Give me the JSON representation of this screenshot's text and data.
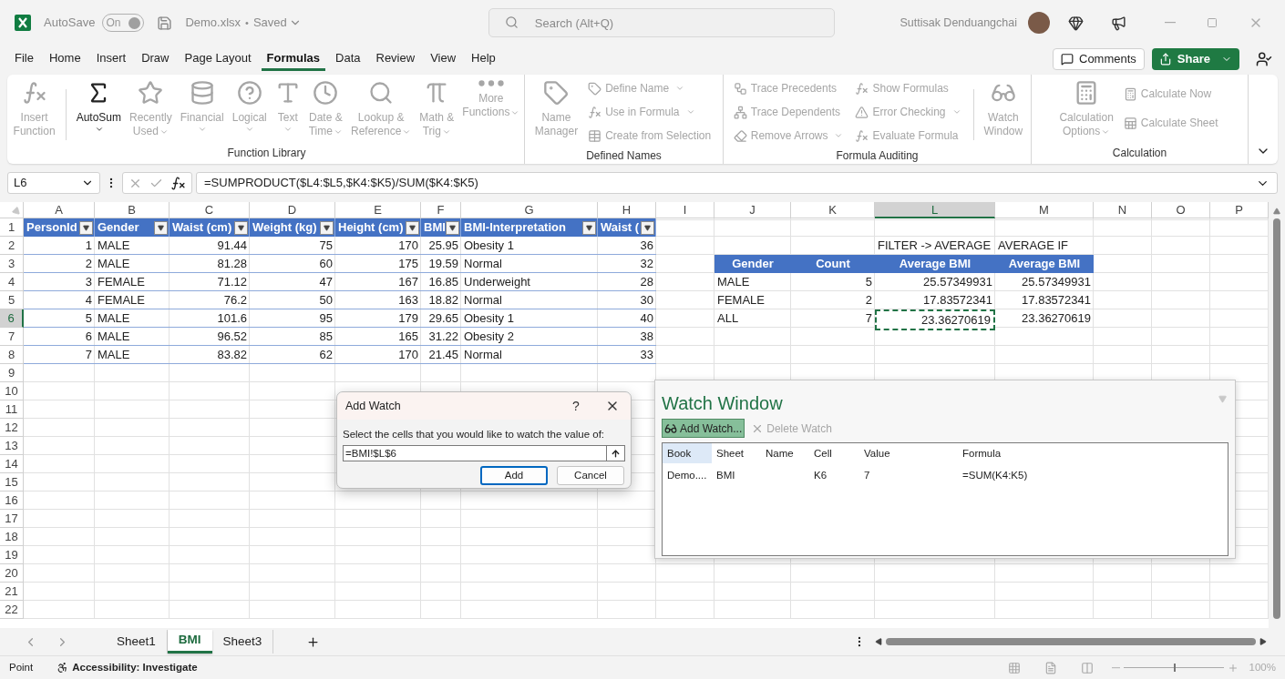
{
  "title_bar": {
    "autosave_label": "AutoSave",
    "autosave_toggle": {
      "label": "On",
      "on": true
    },
    "file_name": "Demo.xlsx",
    "separator": "•",
    "save_status": "Saved",
    "search": {
      "placeholder": "Search (Alt+Q)"
    },
    "user_name": "Suttisak Denduangchai"
  },
  "ribbon_tabs": [
    {
      "label": "File",
      "selected": false
    },
    {
      "label": "Home",
      "selected": false
    },
    {
      "label": "Insert",
      "selected": false
    },
    {
      "label": "Draw",
      "selected": false
    },
    {
      "label": "Page Layout",
      "selected": false
    },
    {
      "label": "Formulas",
      "selected": true
    },
    {
      "label": "Data",
      "selected": false
    },
    {
      "label": "Review",
      "selected": false
    },
    {
      "label": "View",
      "selected": false
    },
    {
      "label": "Help",
      "selected": false
    }
  ],
  "comments_button": "Comments",
  "share_button": "Share",
  "ribbon_groups": [
    {
      "name": "Function Library",
      "items": [
        {
          "kind": "large",
          "lines": [
            "Insert",
            "Function"
          ],
          "dropdown": false,
          "disabled": true
        },
        {
          "kind": "separator"
        },
        {
          "kind": "large",
          "lines": [
            "AutoSum"
          ],
          "dropdown": true,
          "disabled": false
        },
        {
          "kind": "large",
          "lines": [
            "Recently",
            "Used"
          ],
          "dropdown": true,
          "disabled": true
        },
        {
          "kind": "large",
          "lines": [
            "Financial"
          ],
          "dropdown": true,
          "disabled": true
        },
        {
          "kind": "large",
          "lines": [
            "Logical"
          ],
          "dropdown": true,
          "disabled": true
        },
        {
          "kind": "large",
          "lines": [
            "Text"
          ],
          "dropdown": true,
          "disabled": true
        },
        {
          "kind": "large",
          "lines": [
            "Date &",
            "Time"
          ],
          "dropdown": true,
          "disabled": true
        },
        {
          "kind": "large",
          "lines": [
            "Lookup &",
            "Reference"
          ],
          "dropdown": true,
          "disabled": true
        },
        {
          "kind": "large",
          "lines": [
            "Math &",
            "Trig"
          ],
          "dropdown": true,
          "disabled": true
        },
        {
          "kind": "large",
          "lines": [
            "More",
            "Functions"
          ],
          "dropdown": true,
          "disabled": true
        }
      ]
    },
    {
      "name": "Defined Names",
      "items": [
        {
          "kind": "large",
          "lines": [
            "Name",
            "Manager"
          ],
          "dropdown": false,
          "disabled": true
        },
        {
          "kind": "stack",
          "items": [
            {
              "label": "Define Name",
              "dropdown": true,
              "disabled": true
            },
            {
              "label": "Use in Formula",
              "dropdown": true,
              "disabled": true
            },
            {
              "label": "Create from Selection",
              "dropdown": false,
              "disabled": true
            }
          ]
        }
      ]
    },
    {
      "name": "Formula Auditing",
      "items": [
        {
          "kind": "stack",
          "items": [
            {
              "label": "Trace Precedents",
              "dropdown": false,
              "disabled": true
            },
            {
              "label": "Trace Dependents",
              "dropdown": false,
              "disabled": true
            },
            {
              "label": "Remove Arrows",
              "dropdown": true,
              "disabled": true
            }
          ]
        },
        {
          "kind": "stack",
          "items": [
            {
              "label": "Show Formulas",
              "dropdown": false,
              "disabled": true
            },
            {
              "label": "Error Checking",
              "dropdown": true,
              "disabled": true
            },
            {
              "label": "Evaluate Formula",
              "dropdown": false,
              "disabled": true
            }
          ]
        },
        {
          "kind": "separator"
        },
        {
          "kind": "large",
          "lines": [
            "Watch",
            "Window"
          ],
          "dropdown": false,
          "disabled": true
        }
      ]
    },
    {
      "name": "Calculation",
      "items": [
        {
          "kind": "large",
          "lines": [
            "Calculation",
            "Options"
          ],
          "dropdown": true,
          "disabled": true
        },
        {
          "kind": "stack",
          "items": [
            {
              "label": "Calculate Now",
              "dropdown": false,
              "disabled": true
            },
            {
              "label": "Calculate Sheet",
              "dropdown": false,
              "disabled": true
            }
          ]
        }
      ]
    }
  ],
  "formula_bar": {
    "name_box": "L6",
    "formula": "=SUMPRODUCT($L4:$L5,$K4:$K5)/SUM($K4:$K5)"
  },
  "sheet": {
    "column_headers": [
      {
        "label": "A",
        "selected": false
      },
      {
        "label": "B",
        "selected": false
      },
      {
        "label": "C",
        "selected": false
      },
      {
        "label": "D",
        "selected": false
      },
      {
        "label": "E",
        "selected": false
      },
      {
        "label": "F",
        "selected": false
      },
      {
        "label": "G",
        "selected": false
      },
      {
        "label": "H",
        "selected": false
      },
      {
        "label": "I",
        "selected": false
      },
      {
        "label": "J",
        "selected": false
      },
      {
        "label": "K",
        "selected": false
      },
      {
        "label": "L",
        "selected": true
      },
      {
        "label": "M",
        "selected": false
      },
      {
        "label": "N",
        "selected": false
      },
      {
        "label": "O",
        "selected": false
      },
      {
        "label": "P",
        "selected": false
      }
    ],
    "row_headers": [
      {
        "label": "1",
        "selected": false
      },
      {
        "label": "2",
        "selected": false
      },
      {
        "label": "3",
        "selected": false
      },
      {
        "label": "4",
        "selected": false
      },
      {
        "label": "5",
        "selected": false
      },
      {
        "label": "6",
        "selected": true
      },
      {
        "label": "7",
        "selected": false
      },
      {
        "label": "8",
        "selected": false
      },
      {
        "label": "9",
        "selected": false
      },
      {
        "label": "10",
        "selected": false
      },
      {
        "label": "11",
        "selected": false
      },
      {
        "label": "12",
        "selected": false
      },
      {
        "label": "13",
        "selected": false
      },
      {
        "label": "14",
        "selected": false
      },
      {
        "label": "15",
        "selected": false
      },
      {
        "label": "16",
        "selected": false
      },
      {
        "label": "17",
        "selected": false
      },
      {
        "label": "18",
        "selected": false
      },
      {
        "label": "19",
        "selected": false
      },
      {
        "label": "20",
        "selected": false
      },
      {
        "label": "21",
        "selected": false
      },
      {
        "label": "22",
        "selected": false
      }
    ],
    "data_table": {
      "columns": [
        {
          "label": "PersonId",
          "numeric": true
        },
        {
          "label": "Gender",
          "numeric": false
        },
        {
          "label": "Waist (cm)",
          "numeric": true
        },
        {
          "label": "Weight (kg)",
          "numeric": true
        },
        {
          "label": "Height (cm)",
          "numeric": true
        },
        {
          "label": "BMI",
          "numeric": true
        },
        {
          "label": "BMI-Interpretation",
          "numeric": false
        },
        {
          "label": "Waist (",
          "numeric": true
        }
      ],
      "rows": [
        [
          "1",
          "MALE",
          "91.44",
          "75",
          "170",
          "25.95",
          "Obesity 1",
          "36"
        ],
        [
          "2",
          "MALE",
          "81.28",
          "60",
          "175",
          "19.59",
          "Normal",
          "32"
        ],
        [
          "3",
          "FEMALE",
          "71.12",
          "47",
          "167",
          "16.85",
          "Underweight",
          "28"
        ],
        [
          "4",
          "FEMALE",
          "76.2",
          "50",
          "163",
          "18.82",
          "Normal",
          "30"
        ],
        [
          "5",
          "MALE",
          "101.6",
          "95",
          "179",
          "29.65",
          "Obesity 1",
          "40"
        ],
        [
          "6",
          "MALE",
          "96.52",
          "85",
          "165",
          "31.22",
          "Obesity 2",
          "38"
        ],
        [
          "7",
          "MALE",
          "83.82",
          "62",
          "170",
          "21.45",
          "Normal",
          "33"
        ]
      ]
    },
    "summary": {
      "notes": [
        "FILTER -> AVERAGE",
        "AVERAGE IF"
      ],
      "columns": [
        "Gender",
        "Count",
        "Average BMI",
        "Average BMI"
      ],
      "rows": [
        [
          {
            "text": "MALE",
            "selected": false
          },
          {
            "text": "5",
            "selected": false
          },
          {
            "text": "25.57349931",
            "selected": false
          },
          {
            "text": "25.57349931",
            "selected": false
          }
        ],
        [
          {
            "text": "FEMALE",
            "selected": false
          },
          {
            "text": "2",
            "selected": false
          },
          {
            "text": "17.83572341",
            "selected": false
          },
          {
            "text": "17.83572341",
            "selected": false
          }
        ],
        [
          {
            "text": "ALL",
            "selected": false
          },
          {
            "text": "7",
            "selected": false
          },
          {
            "text": "23.36270619",
            "selected": true
          },
          {
            "text": "23.36270619",
            "selected": false
          }
        ]
      ]
    }
  },
  "add_watch_dialog": {
    "title": "Add Watch",
    "help": "?",
    "prompt": "Select the cells that you would like to watch the value of:",
    "value": "=BMI!$L$6",
    "buttons": [
      "Add",
      "Cancel"
    ]
  },
  "watch_window": {
    "title": "Watch Window",
    "toolbar": [
      {
        "label": "Add Watch...",
        "active": true,
        "disabled": false
      },
      {
        "label": "Delete Watch",
        "active": false,
        "disabled": true
      }
    ],
    "columns": [
      {
        "label": "Book",
        "selected": true
      },
      {
        "label": "Sheet",
        "selected": false
      },
      {
        "label": "Name",
        "selected": false
      },
      {
        "label": "Cell",
        "selected": false
      },
      {
        "label": "Value",
        "selected": false
      },
      {
        "label": "Formula",
        "selected": false
      }
    ],
    "rows": [
      {
        "book": "Demo....",
        "sheet": "BMI",
        "cell": "K6",
        "value": "7",
        "formula": "=SUM(K4:K5)"
      }
    ]
  },
  "sheet_tabs": [
    {
      "label": "Sheet1",
      "selected": false
    },
    {
      "label": "BMI",
      "selected": true
    },
    {
      "label": "Sheet3",
      "selected": false
    }
  ],
  "status_bar": {
    "mode": "Point",
    "accessibility": "Accessibility: Investigate",
    "zoom": {
      "level": 0.5,
      "label": "100%"
    }
  }
}
